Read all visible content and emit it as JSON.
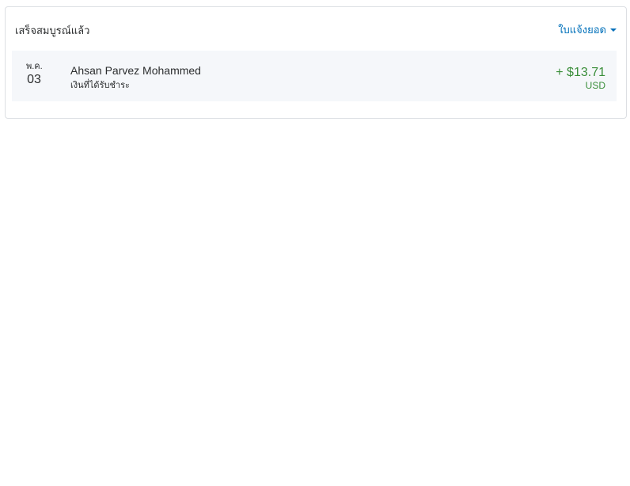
{
  "completed_section": {
    "title": "เสร็จสมบูรณ์แล้ว",
    "statement_link": "ใบแจ้งยอด"
  },
  "transactions": [
    {
      "month": "พ.ค.",
      "day": "03",
      "name": "Ahsan Parvez Mohammed",
      "description": "เงินที่ได้รับชำระ",
      "amount": "+ $13.71",
      "currency": "USD"
    }
  ],
  "colors": {
    "link": "#0070ba",
    "positive_amount": "#3a8e3a",
    "row_background": "#f5f7fa"
  },
  "icons": {
    "statement_dropdown": "caret-down-icon"
  }
}
